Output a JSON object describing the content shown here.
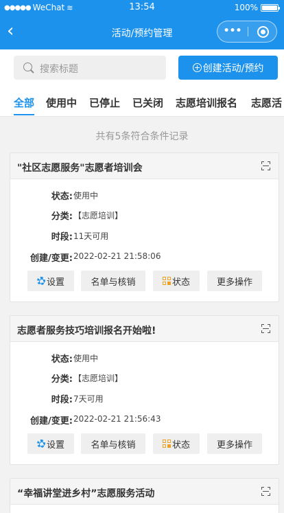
{
  "status_bar": {
    "carrier": "WeChat",
    "signal_dots": "●●●●●",
    "time": "13:54",
    "battery": "100%"
  },
  "nav": {
    "title": "活动/预约管理",
    "back_glyph": "‹",
    "more_glyph": "•••"
  },
  "search": {
    "placeholder": "搜索标题"
  },
  "create_button": {
    "label": "创建活动/预约"
  },
  "tabs": [
    {
      "label": "全部",
      "active": true
    },
    {
      "label": "使用中"
    },
    {
      "label": "已停止"
    },
    {
      "label": "已关闭"
    },
    {
      "label": "志愿培训报名"
    },
    {
      "label": "志愿活"
    }
  ],
  "result_count": "共有5条符合条件记录",
  "field_labels": {
    "status": "状态:",
    "category": "分类:",
    "period": "时段:",
    "created": "创建/变更:"
  },
  "action_labels": {
    "settings": "设置",
    "roster": "名单与核销",
    "status": "状态",
    "more": "更多操作"
  },
  "records": [
    {
      "title": "\"社区志愿服务\"志愿者培训会",
      "status": "使用中",
      "category": "【志愿培训】",
      "period": "11天可用",
      "created": "2022-02-21 21:58:06"
    },
    {
      "title": "志愿者服务技巧培训报名开始啦!",
      "status": "使用中",
      "category": "【志愿培训】",
      "period": "7天可用",
      "created": "2022-02-21 21:56:43"
    },
    {
      "title": "“幸福讲堂进乡村”志愿服务活动"
    }
  ],
  "colors": {
    "primary": "#1c92ec",
    "status_icon": "#f0a020",
    "background": "#f2f2f2"
  },
  "icons": {
    "settings": "gear-icon",
    "status": "status-grid-icon",
    "qrcode": "qrcode-icon",
    "search": "search-icon"
  }
}
